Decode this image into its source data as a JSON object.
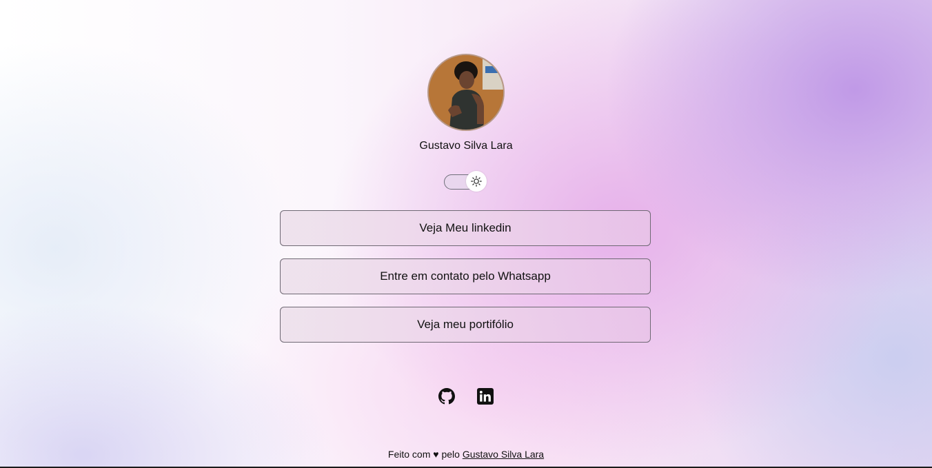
{
  "profile": {
    "name": "Gustavo Silva Lara",
    "avatar_icon": "profile-photo"
  },
  "theme_toggle": {
    "icon": "sun-icon",
    "state": "light"
  },
  "links": [
    {
      "label": "Veja Meu linkedin"
    },
    {
      "label": "Entre em contato pelo Whatsapp"
    },
    {
      "label": "Veja meu portifólio"
    }
  ],
  "social": [
    {
      "icon": "github-icon"
    },
    {
      "icon": "linkedin-icon"
    }
  ],
  "footer": {
    "prefix": "Feito com ♥ pelo",
    "author_link": "Gustavo Silva Lara"
  },
  "colors": {
    "accent_purple": "#c39be6",
    "accent_pink": "#e4a8e8",
    "text": "#111111"
  }
}
